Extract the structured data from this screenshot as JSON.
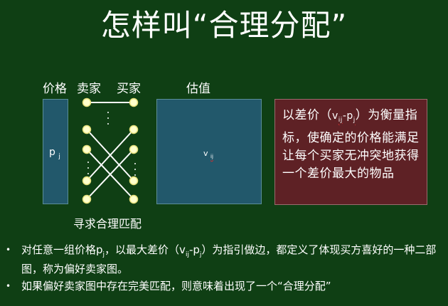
{
  "title": "怎样叫“合理分配”",
  "columns": {
    "price": "价格",
    "seller": "卖家",
    "buyer": "买家",
    "valuation": "估值"
  },
  "price_box": {
    "var": "p",
    "sub": "j"
  },
  "value_box": {
    "var": "v",
    "sub": "ij"
  },
  "callout": {
    "before": "以差价（",
    "v": "v",
    "v_sub": "ij",
    "minus": "-p",
    "p_sub": "j",
    "after": "）为衡量指标，使确定的价格能满足让每个买家无冲突地获得一个差价最大的物品"
  },
  "caption": "寻求合理匹配",
  "bullets": [
    {
      "dot": "•",
      "t1": "对任意一组价格p",
      "s1": "j",
      "t2": "，以最大差价（v",
      "s2": "ij",
      "t3": "-p",
      "s3": "j",
      "t4": "）为指引做边，都定义了体现买方喜好的一种二部图，称为偏好卖家图。"
    },
    {
      "dot": "•",
      "text": "如果偏好卖家图中存在完美匹配，则意味着出现了一个“合理分配”"
    }
  ],
  "colors": {
    "background": "#0f3f14",
    "box_fill": "#22586b",
    "callout_fill": "#5e2125",
    "node_fill": "#ffffcc",
    "node_stroke": "#e6e07a",
    "edge": "#ffffff"
  }
}
